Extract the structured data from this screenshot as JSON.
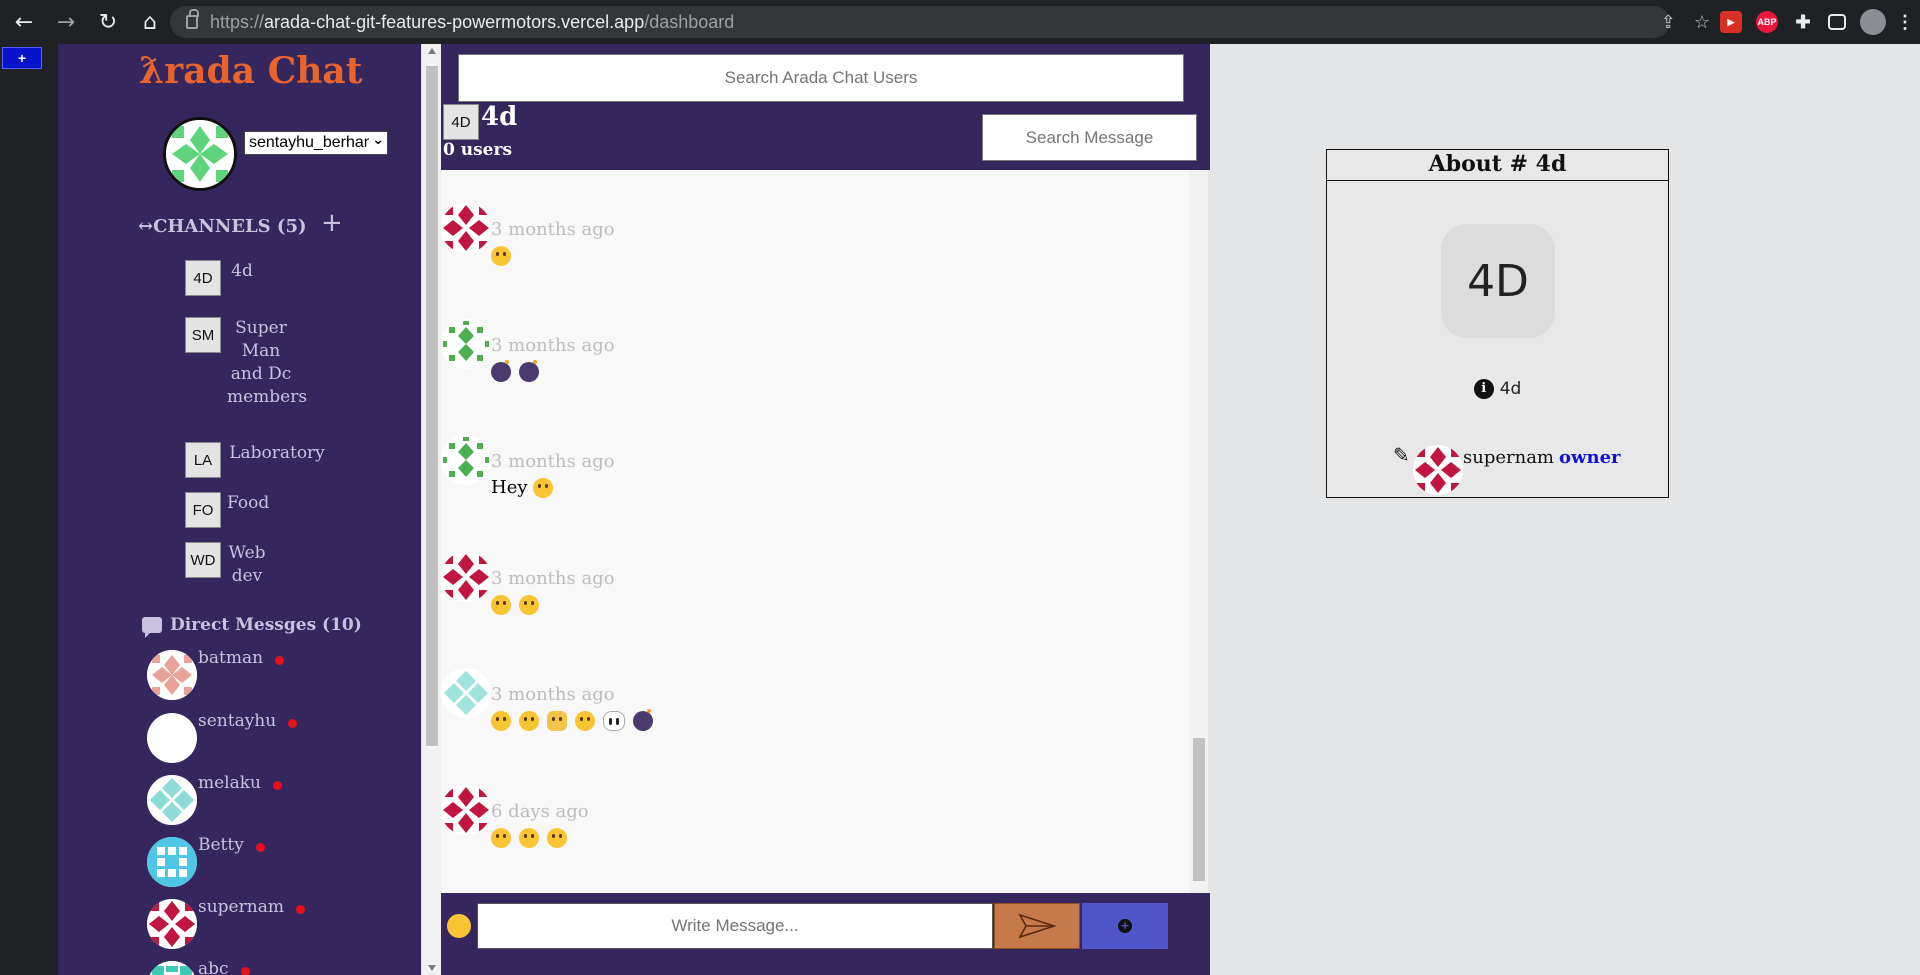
{
  "browser": {
    "url_prefix": "https://",
    "url_host": "arada-chat-git-features-powermotors.vercel.app",
    "url_path": "/dashboard",
    "ext_abp": "ABP"
  },
  "corner_button": "+",
  "sidebar": {
    "brand": "ƛrada Chat",
    "user_select_value": "sentayhu_berhanu",
    "channels_heading": "↔CHANNELS (5)",
    "add_channel": "+",
    "channels": [
      {
        "badge": "4D",
        "name": "4d"
      },
      {
        "badge": "SM",
        "name": "Super Man and Dc members"
      },
      {
        "badge": "LA",
        "name": "Laboratory"
      },
      {
        "badge": "FO",
        "name": "Food"
      },
      {
        "badge": "WD",
        "name": "Web dev"
      }
    ],
    "dm_heading": "Direct Messges (10)",
    "dms": [
      {
        "name": "batman"
      },
      {
        "name": "sentayhu"
      },
      {
        "name": "melaku"
      },
      {
        "name": "Betty"
      },
      {
        "name": "supernam"
      },
      {
        "name": "abc"
      }
    ]
  },
  "chat": {
    "user_search_placeholder": "Search Arada Chat Users",
    "channel_badge": "4D",
    "channel_title": "4d",
    "users_count": "0 users",
    "message_search_placeholder": "Search Message",
    "messages": [
      {
        "time": "3 months ago",
        "text": ""
      },
      {
        "time": "3 months ago",
        "text": ""
      },
      {
        "time": "3 months ago",
        "text": "Hey"
      },
      {
        "time": "3 months ago",
        "text": ""
      },
      {
        "time": "3 months ago",
        "text": ""
      },
      {
        "time": "6 days ago",
        "text": ""
      }
    ],
    "composer_placeholder": "Write Message..."
  },
  "about": {
    "title": "About # 4d",
    "badge": "4D",
    "info_name": "4d",
    "owner_name": "supernam",
    "owner_role": "owner"
  },
  "colors": {
    "sidebar_bg": "#35275e",
    "brand": "#e8642c",
    "send_button": "#c67a4b",
    "attach_button": "#5055c9",
    "online_dot": "#e8101a",
    "owner_role": "#1212d6"
  }
}
